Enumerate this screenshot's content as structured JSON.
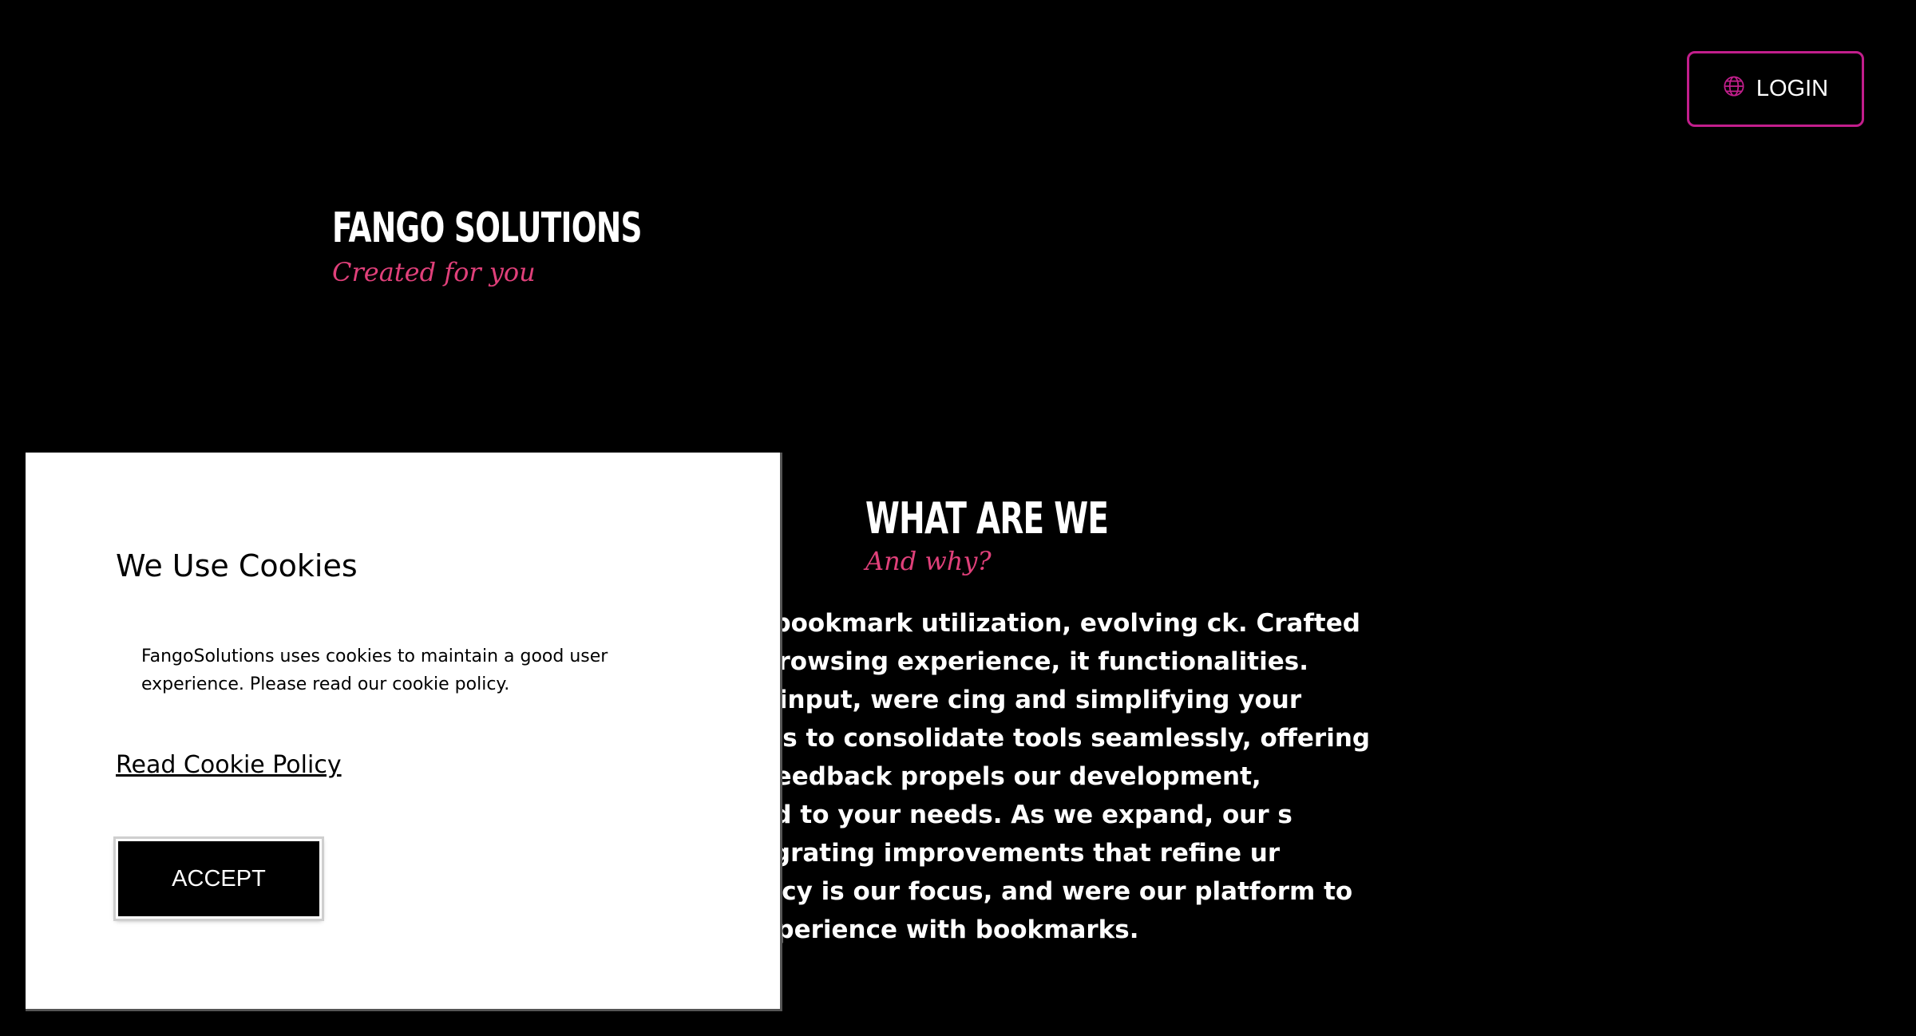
{
  "colors": {
    "background": "#000000",
    "accent": "#e0407a",
    "login_border": "#c21e8c",
    "modal_background": "#ffffff"
  },
  "header": {
    "login_label": "LOGIN",
    "login_icon": "globe-icon"
  },
  "brand": {
    "title": "FANGO SOLUTIONS",
    "tagline": "Created for you"
  },
  "about": {
    "title": "WHAT ARE WE",
    "subtitle": "And why?",
    "body": "zes streamlined bookmark utilization, evolving ck. Crafted for an intuitive browsing experience, it functionalities. Focused on user input, were cing and simplifying your interaction with is to consolidate tools seamlessly, offering an erface. User feedback propels our development, evolution tailored to your needs. As we expand, our s steadfast in integrating improvements that refine ur browsing efficiency is our focus, and were our platform to optimize your experience with bookmarks."
  },
  "cookie_modal": {
    "title": "We Use Cookies",
    "body": "FangoSolutions uses cookies to maintain a good user experience. Please read our cookie policy.",
    "policy_link": "Read Cookie Policy",
    "accept_label": "ACCEPT"
  }
}
